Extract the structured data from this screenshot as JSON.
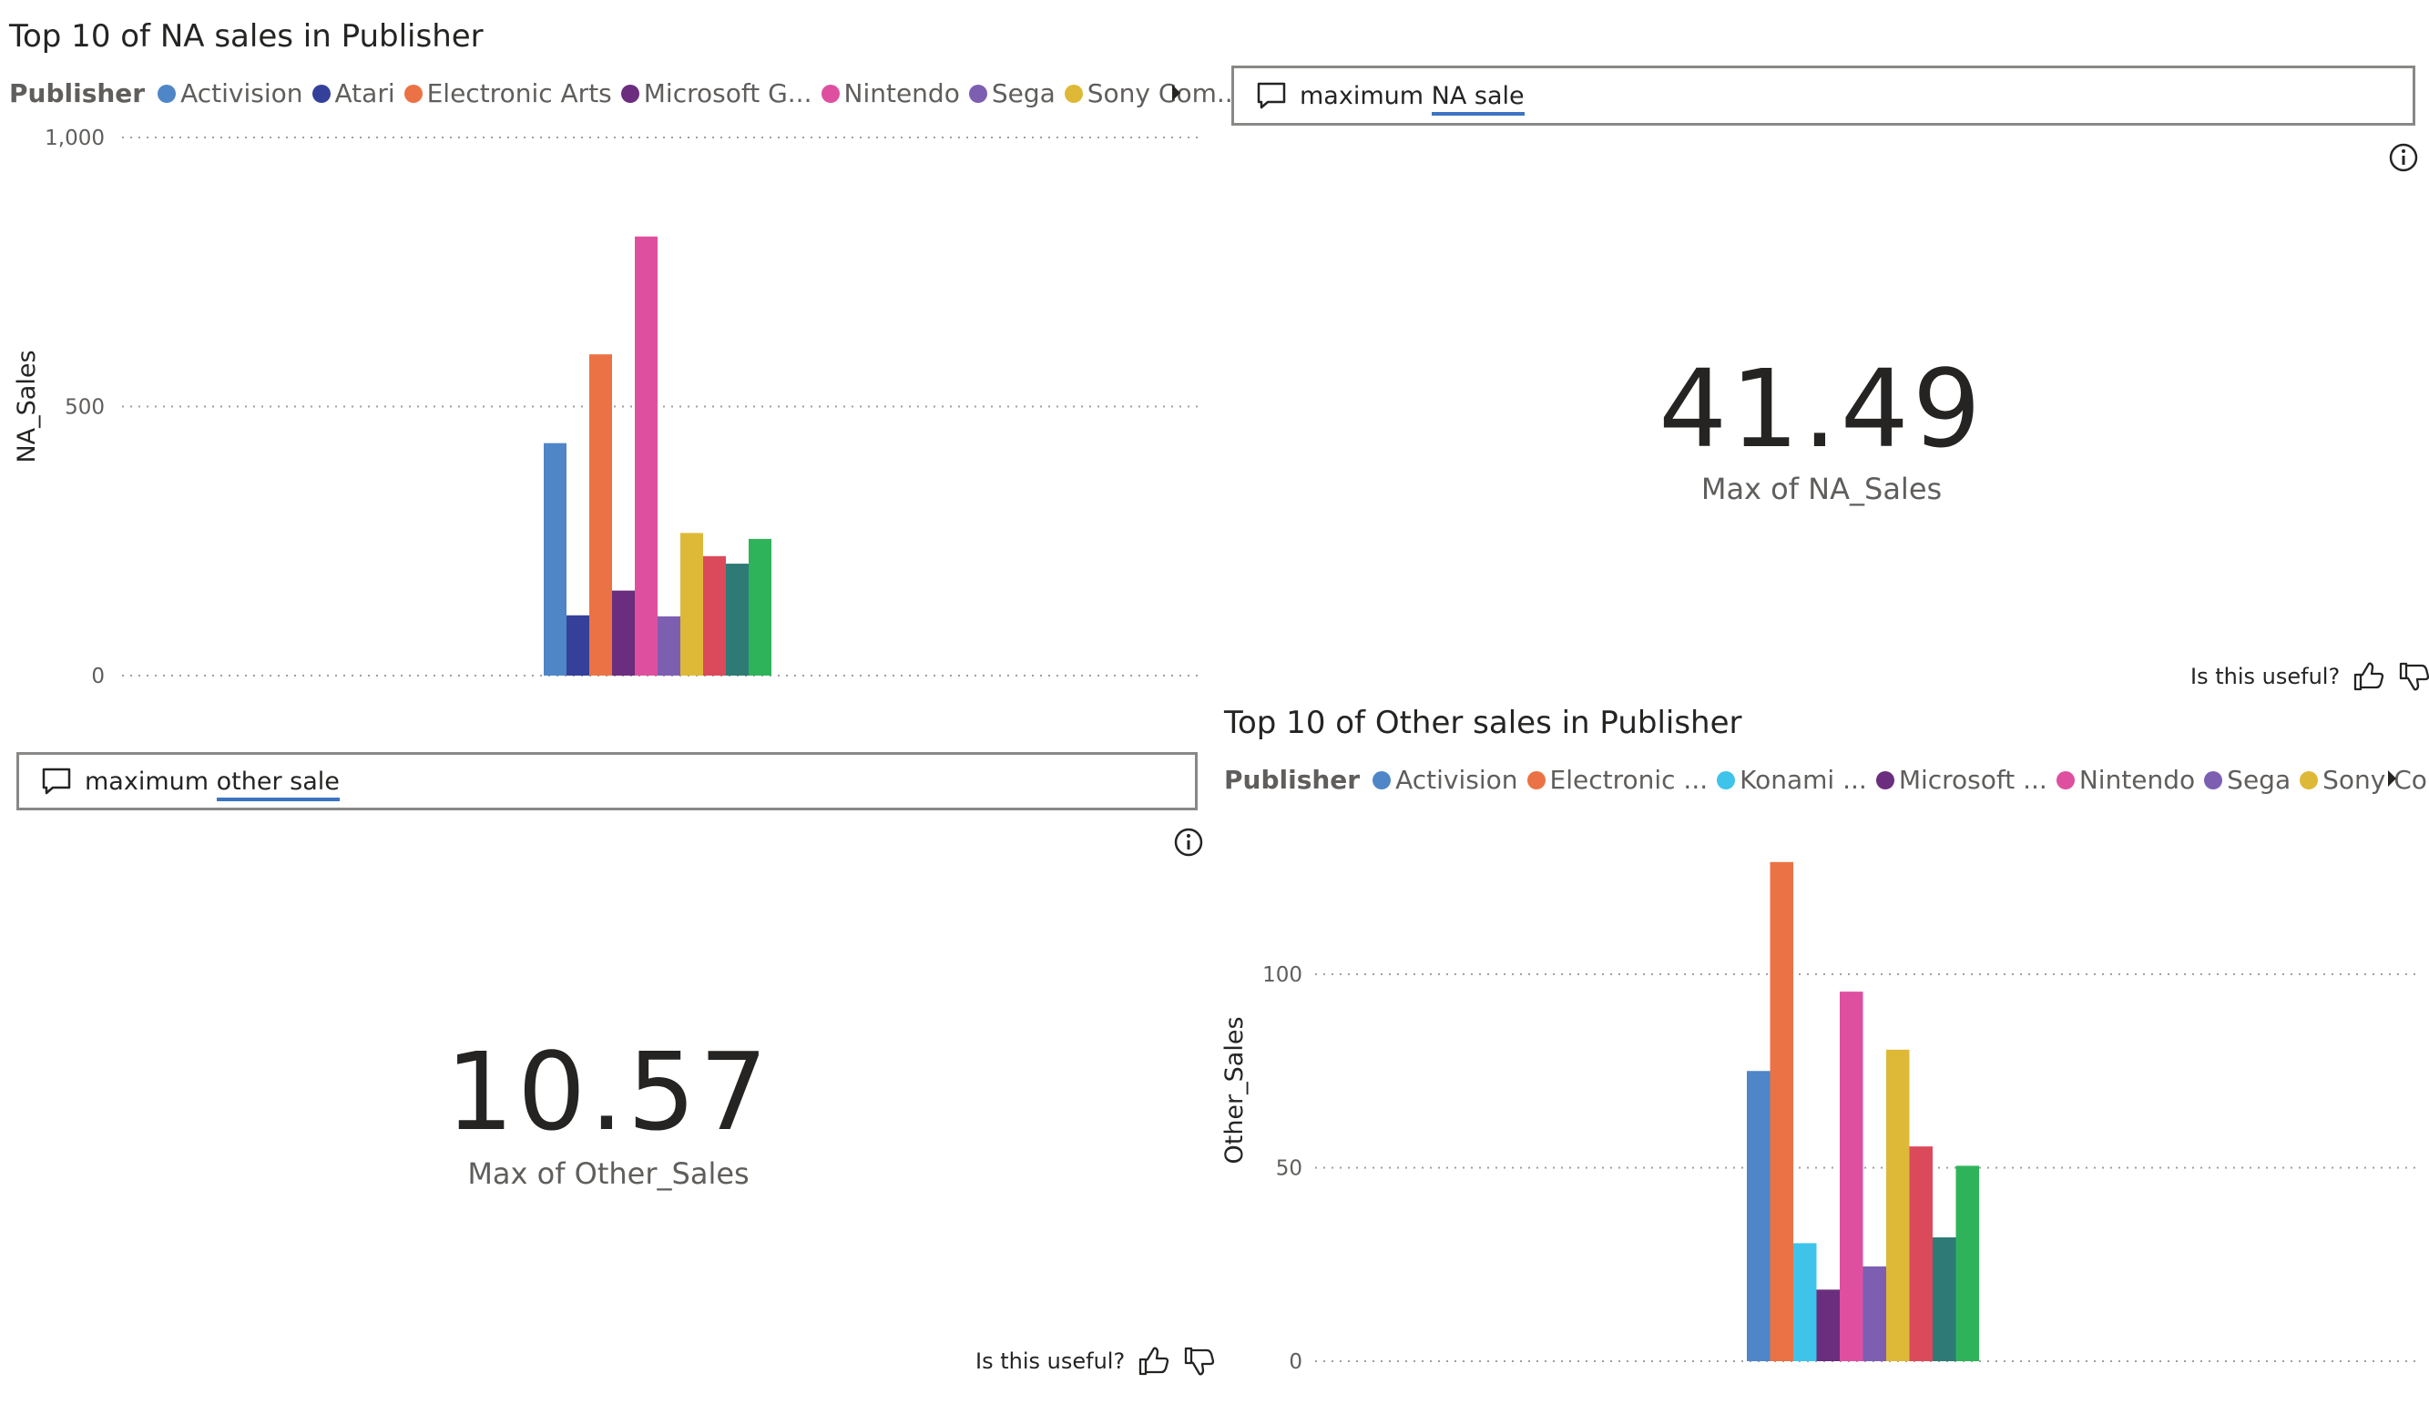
{
  "chart_data": [
    {
      "type": "bar",
      "title": "Top 10 of NA sales in Publisher",
      "legend_title": "Publisher",
      "legend_position": "top",
      "legend": [
        {
          "name": "Activision",
          "color": "#4e86c7"
        },
        {
          "name": "Atari",
          "color": "#35409a"
        },
        {
          "name": "Electronic Arts",
          "color": "#eb7244"
        },
        {
          "name": "Microsoft G...",
          "color": "#6b2d7e"
        },
        {
          "name": "Nintendo",
          "color": "#de4fa0"
        },
        {
          "name": "Sega",
          "color": "#7d5fb2"
        },
        {
          "name": "Sony Com...",
          "color": "#ddb937"
        }
      ],
      "bars": [
        {
          "value": 432,
          "color": "#4e86c7"
        },
        {
          "value": 112,
          "color": "#35409a"
        },
        {
          "value": 597,
          "color": "#eb7244"
        },
        {
          "value": 158,
          "color": "#6b2d7e"
        },
        {
          "value": 816,
          "color": "#de4fa0"
        },
        {
          "value": 110,
          "color": "#7d5fb2"
        },
        {
          "value": 265,
          "color": "#ddb937"
        },
        {
          "value": 222,
          "color": "#db4a5b"
        },
        {
          "value": 208,
          "color": "#2e7a76"
        },
        {
          "value": 254,
          "color": "#2fb35a"
        }
      ],
      "xlabel": "",
      "ylabel": "NA_Sales",
      "ylim": [
        0,
        1000
      ],
      "yticks": [
        0,
        500,
        1000
      ],
      "ytick_labels": [
        "0",
        "500",
        "1,000"
      ],
      "grid": true
    },
    {
      "type": "bar",
      "title": "Top 10 of Other sales in Publisher",
      "legend_title": "Publisher",
      "legend_position": "top",
      "legend": [
        {
          "name": "Activision",
          "color": "#4e86c7"
        },
        {
          "name": "Electronic ...",
          "color": "#eb7244"
        },
        {
          "name": "Konami ...",
          "color": "#3ec4ea"
        },
        {
          "name": "Microsoft ...",
          "color": "#6b2d7e"
        },
        {
          "name": "Nintendo",
          "color": "#de4fa0"
        },
        {
          "name": "Sega",
          "color": "#7d5fb2"
        },
        {
          "name": "Sony Co...",
          "color": "#ddb937"
        }
      ],
      "bars": [
        {
          "value": 75,
          "color": "#4e86c7"
        },
        {
          "value": 129,
          "color": "#eb7244"
        },
        {
          "value": 30.5,
          "color": "#3ec4ea"
        },
        {
          "value": 18.5,
          "color": "#6b2d7e"
        },
        {
          "value": 95.5,
          "color": "#de4fa0"
        },
        {
          "value": 24.5,
          "color": "#7d5fb2"
        },
        {
          "value": 80.5,
          "color": "#ddb937"
        },
        {
          "value": 55.5,
          "color": "#db4a5b"
        },
        {
          "value": 32,
          "color": "#2e7a76"
        },
        {
          "value": 50.5,
          "color": "#2fb35a"
        }
      ],
      "xlabel": "",
      "ylabel": "Other_Sales",
      "ylim": [
        0,
        140
      ],
      "yticks": [
        0,
        50,
        100
      ],
      "ytick_labels": [
        "0",
        "50",
        "100"
      ],
      "grid": true
    }
  ],
  "qa_na": {
    "question_prefix": "maximum ",
    "question_underlined": "NA sale",
    "kpi_value": "41.49",
    "kpi_label": "Max of NA_Sales",
    "useful_text": "Is this useful?"
  },
  "qa_other": {
    "question_prefix": "maximum ",
    "question_underlined": "other sale",
    "kpi_value": "10.57",
    "kpi_label": "Max of Other_Sales",
    "useful_text": "Is this useful?"
  },
  "colors": {
    "text": "#252423",
    "muted": "#605e5c",
    "grid": "#c8c6c4",
    "underline": "#3b74c2"
  },
  "icons": {
    "comment": "comment-icon",
    "info": "info-icon",
    "thumbs_up": "thumbs-up-icon",
    "thumbs_down": "thumbs-down-icon",
    "legend_next": "chevron-right-icon"
  }
}
